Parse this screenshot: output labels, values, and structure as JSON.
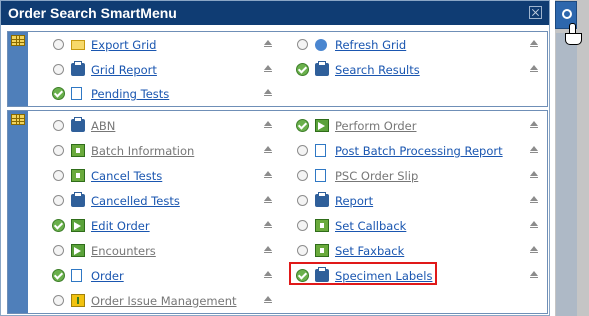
{
  "title": "Order Search SmartMenu",
  "colors": {
    "titlebar": "#0f3c73",
    "link": "#1a56b0",
    "muted": "#777777",
    "highlight": "#e01919",
    "check": "#6ab04c"
  },
  "section1": {
    "icon": "grid-icon",
    "items": [
      {
        "label": "Export Grid",
        "state": "radio",
        "icon": "folder-icon",
        "style": "link"
      },
      {
        "label": "Refresh Grid",
        "state": "radio",
        "icon": "refresh-icon",
        "style": "link"
      },
      {
        "label": "Grid Report",
        "state": "radio",
        "icon": "printer-icon",
        "style": "link"
      },
      {
        "label": "Search Results",
        "state": "checked",
        "icon": "printer-icon",
        "style": "link"
      },
      {
        "label": "Pending Tests",
        "state": "checked",
        "icon": "document-icon",
        "style": "link"
      }
    ]
  },
  "section2": {
    "icon": "grid-icon",
    "items": [
      {
        "label": "ABN",
        "state": "radio",
        "icon": "printer-icon",
        "style": "muted"
      },
      {
        "label": "Perform Order",
        "state": "checked",
        "icon": "arrow-icon",
        "style": "muted"
      },
      {
        "label": "Batch Information",
        "state": "radio",
        "icon": "batch-icon",
        "style": "muted"
      },
      {
        "label": "Post Batch Processing Report",
        "state": "radio",
        "icon": "document-icon",
        "style": "link"
      },
      {
        "label": "Cancel Tests",
        "state": "radio",
        "icon": "batch-icon",
        "style": "link"
      },
      {
        "label": "PSC Order Slip",
        "state": "radio",
        "icon": "document-icon",
        "style": "muted"
      },
      {
        "label": "Cancelled Tests",
        "state": "radio",
        "icon": "printer-icon",
        "style": "link"
      },
      {
        "label": "Report",
        "state": "radio",
        "icon": "printer-icon",
        "style": "link"
      },
      {
        "label": "Edit Order",
        "state": "checked",
        "icon": "arrow-icon",
        "style": "link"
      },
      {
        "label": "Set Callback",
        "state": "radio",
        "icon": "batch-icon",
        "style": "link"
      },
      {
        "label": "Encounters",
        "state": "radio",
        "icon": "arrow-icon",
        "style": "muted"
      },
      {
        "label": "Set Faxback",
        "state": "radio",
        "icon": "batch-icon",
        "style": "link"
      },
      {
        "label": "Order",
        "state": "checked",
        "icon": "document-icon",
        "style": "link"
      },
      {
        "label": "Specimen Labels",
        "state": "checked",
        "icon": "printer-icon",
        "style": "link",
        "highlighted": true
      },
      {
        "label": "Order Issue Management",
        "state": "radio",
        "icon": "warning-icon",
        "style": "muted"
      }
    ]
  }
}
